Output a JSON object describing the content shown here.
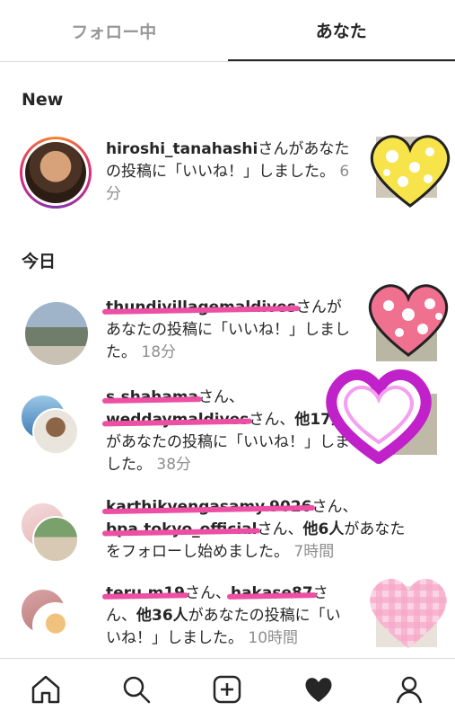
{
  "tabs": {
    "following": "フォロー中",
    "you": "あなた"
  },
  "sections": {
    "new": "New",
    "today": "今日"
  },
  "notifications": [
    {
      "user": "hiroshi_tanahashi",
      "text": "さんがあなたの投稿に「いいね！」しました。",
      "time": "6分"
    },
    {
      "user": "thundivillagemaldives",
      "text": "さんがあなたの投稿に「いいね！」しました。",
      "time": "18分"
    },
    {
      "user1": "s.shahama",
      "sep": "さん、",
      "user2": "weddaymaldives",
      "mid": "さん、",
      "others": "他17人",
      "text": "があなたの投稿に「いいね！」しました。",
      "time": "38分"
    },
    {
      "user1": "karthikvengasamy.9026",
      "sep": "さん、",
      "user2": "bpa.tokyo_official",
      "mid": "さん、",
      "others": "他6人",
      "text": "があなたをフォローし始めました。",
      "time": "7時間"
    },
    {
      "user1": "teru.m19",
      "sep": "さん、",
      "user2": "hakase87",
      "mid": "さん、",
      "others": "他36人",
      "text": "があなたの投稿に「いいね！」しました。",
      "time": "10時間"
    }
  ],
  "nav": [
    "home-icon",
    "search-icon",
    "add-post-icon",
    "heart-icon",
    "profile-icon"
  ]
}
